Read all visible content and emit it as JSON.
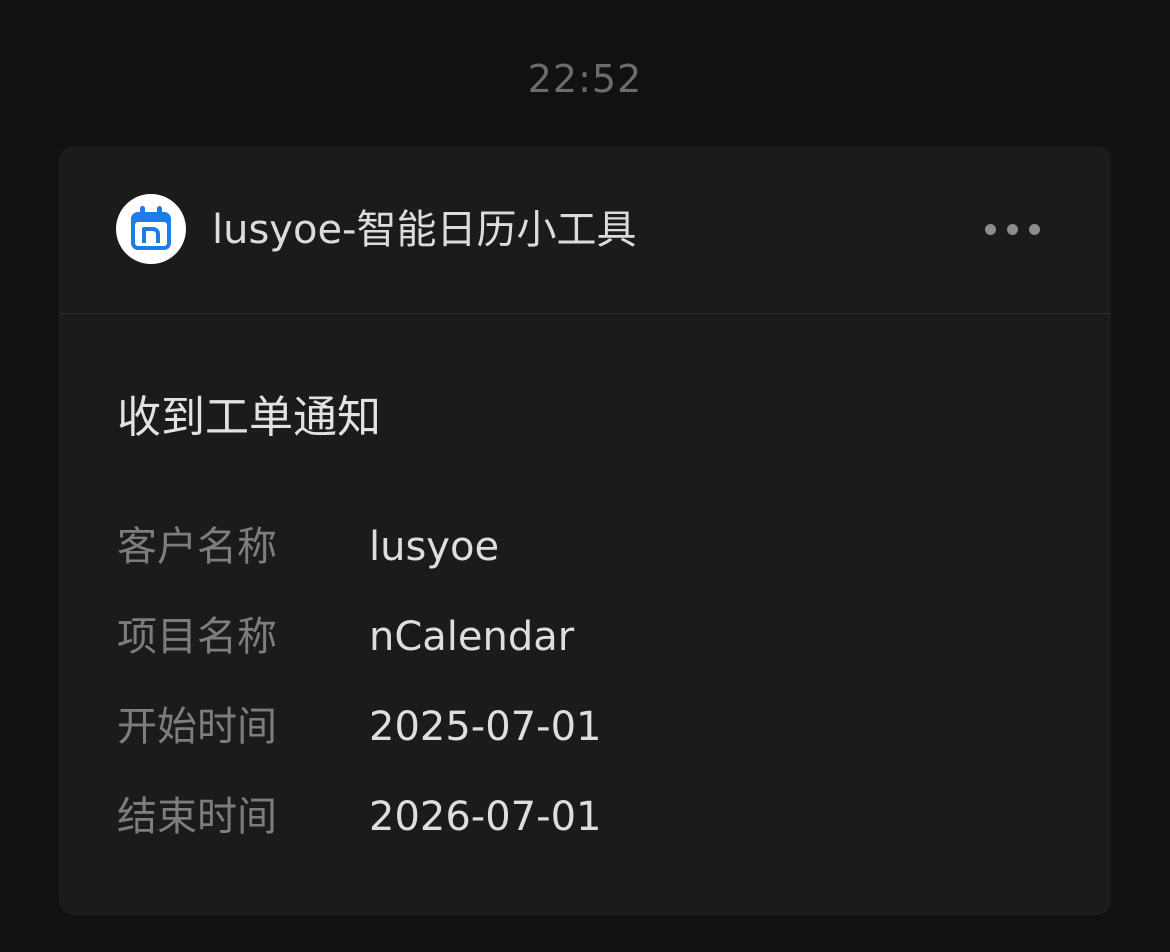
{
  "timestamp": "22:52",
  "card": {
    "app_icon": "calendar-n-icon",
    "app_name": "lusyoe-智能日历小工具",
    "more_icon": "more-horizontal-icon",
    "title": "收到工单通知",
    "fields": [
      {
        "label": "客户名称",
        "value": "lusyoe"
      },
      {
        "label": "项目名称",
        "value": "nCalendar"
      },
      {
        "label": "开始时间",
        "value": "2025-07-01"
      },
      {
        "label": "结束时间",
        "value": "2026-07-01"
      }
    ]
  },
  "colors": {
    "background": "#111111",
    "card": "#1b1b1b",
    "icon_blue": "#1e7ce8"
  }
}
